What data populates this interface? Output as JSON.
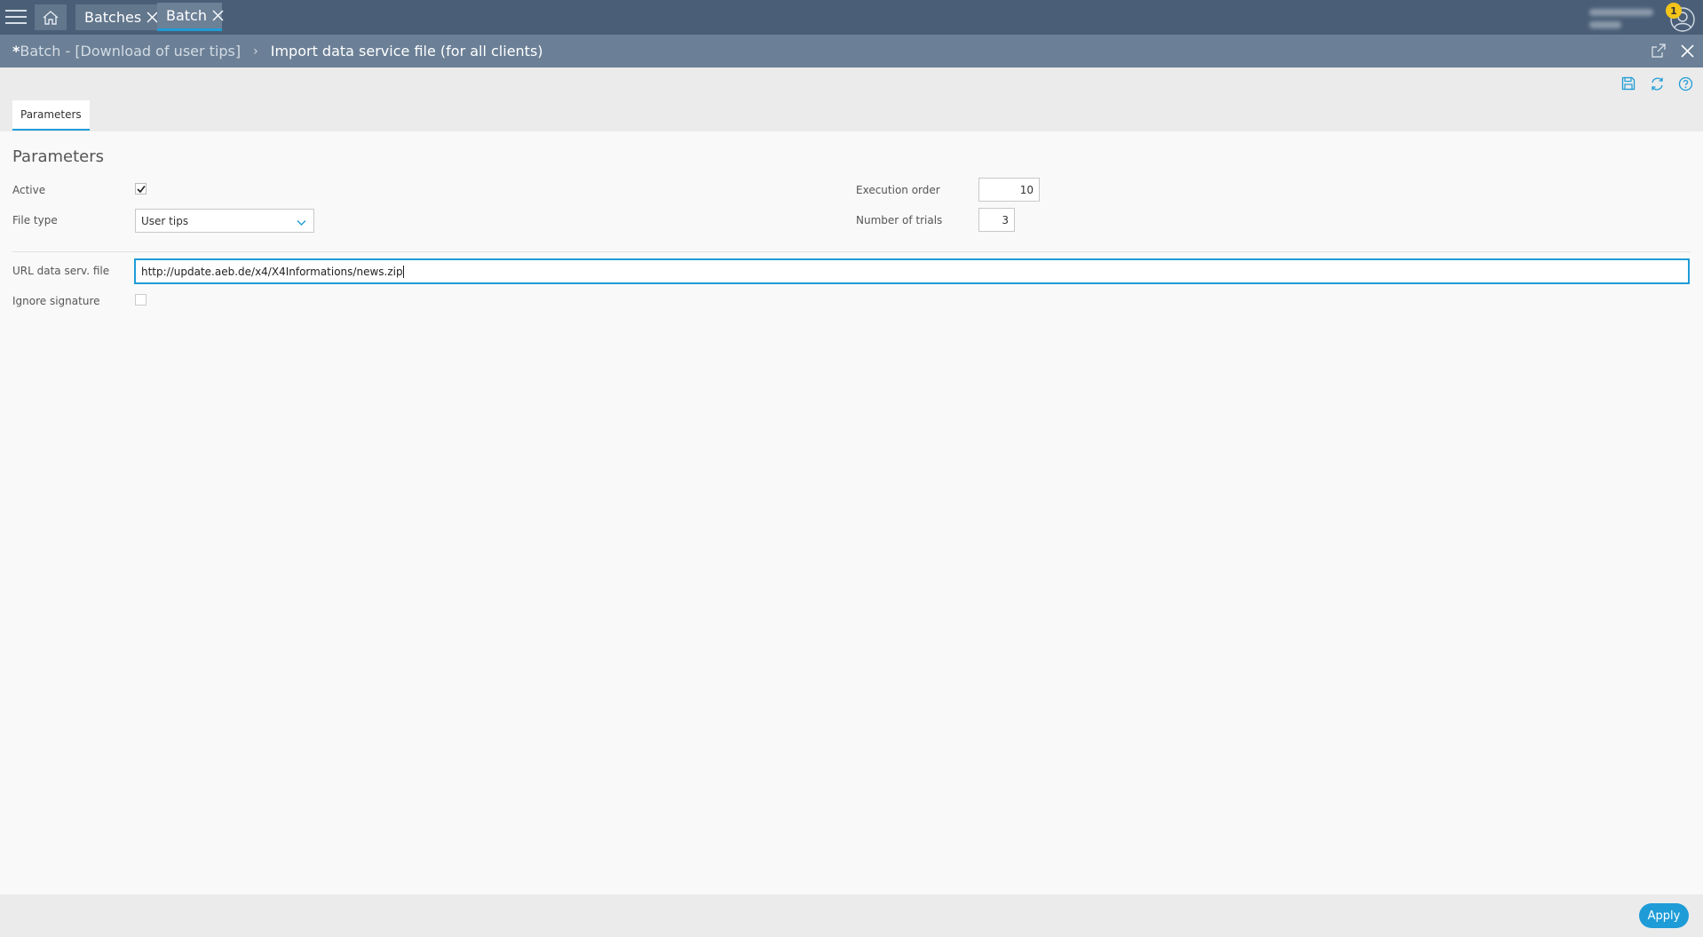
{
  "topbar": {
    "tabs": [
      {
        "label": "Batches"
      },
      {
        "label": "Batch"
      }
    ],
    "notification_count": "1"
  },
  "titlebar": {
    "modified_marker": "*",
    "parent": "Batch - [Download of user tips]",
    "separator": "›",
    "current": "Import data service file (for all clients)"
  },
  "tabs": {
    "parameters": "Parameters"
  },
  "form": {
    "section_title": "Parameters",
    "active_label": "Active",
    "active_checked": true,
    "file_type_label": "File type",
    "file_type_value": "User tips",
    "execution_order_label": "Execution order",
    "execution_order_value": "10",
    "number_of_trials_label": "Number of trials",
    "number_of_trials_value": "3",
    "url_label": "URL data serv. file",
    "url_value": "http://update.aeb.de/x4/X4Informations/news.zip",
    "ignore_signature_label": "Ignore signature",
    "ignore_signature_checked": false
  },
  "footer": {
    "apply_label": "Apply"
  },
  "colors": {
    "topbar": "#4a5f77",
    "titlebar": "#6b8096",
    "accent": "#1e9cd7",
    "badge": "#f3c419"
  }
}
